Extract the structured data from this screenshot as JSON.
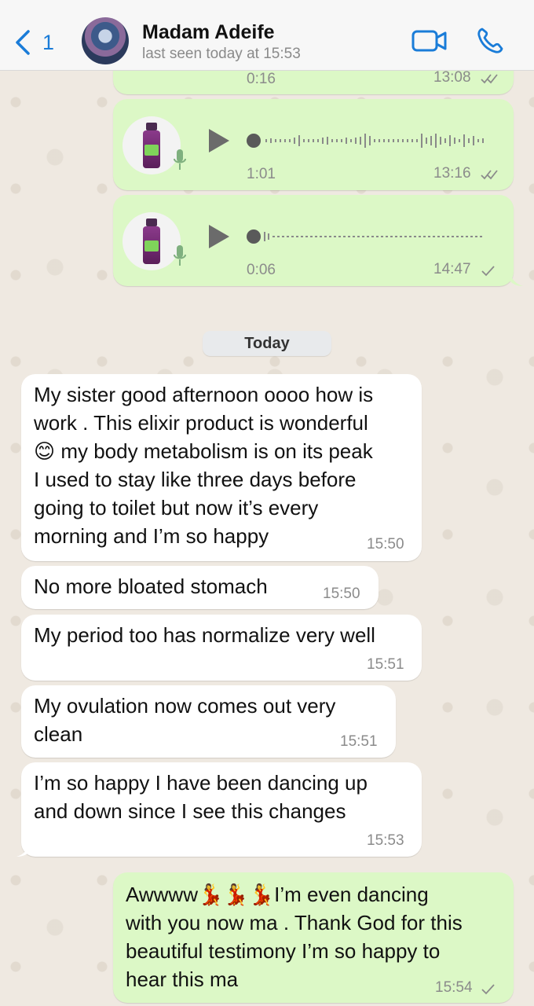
{
  "header": {
    "back_count": "1",
    "contact_name": "Madam Adeife",
    "last_seen": "last seen today at 15:53"
  },
  "voice_notes": [
    {
      "duration": "0:16",
      "time": "13:08",
      "status": "read"
    },
    {
      "duration": "1:01",
      "time": "13:16",
      "status": "read"
    },
    {
      "duration": "0:06",
      "time": "14:47",
      "status": "sent"
    }
  ],
  "day_separator": "Today",
  "messages": [
    {
      "lines": [
        "My sister good afternoon oooo how is",
        "work . This elixir product is wonderful",
        "😊 my body metabolism is on its peak",
        "I used to stay like three days before",
        "going to toilet but now it’s every",
        "morning and I’m so happy"
      ],
      "time": "15:50"
    },
    {
      "lines": [
        "No more bloated stomach"
      ],
      "time": "15:50"
    },
    {
      "lines": [
        "My period too has normalize very well"
      ],
      "time": "15:51"
    },
    {
      "lines": [
        "My ovulation now comes out very",
        "clean"
      ],
      "time": "15:51"
    },
    {
      "lines": [
        "I’m so happy I have been dancing up",
        "and down since I see this changes"
      ],
      "time": "15:53"
    }
  ],
  "reply": {
    "lines": [
      "Awwww💃💃💃I’m even dancing",
      "with you now ma . Thank God for this",
      "beautiful testimony I’m so happy to",
      "hear this ma"
    ],
    "time": "15:54"
  },
  "icons": {
    "read_ticks": "✓✓",
    "sent_tick": "✓"
  },
  "colors": {
    "accent": "#1a7cd8",
    "outgoing_bubble": "#dcf8c6",
    "incoming_bubble": "#ffffff",
    "read_tick": "#8b8b8b"
  }
}
